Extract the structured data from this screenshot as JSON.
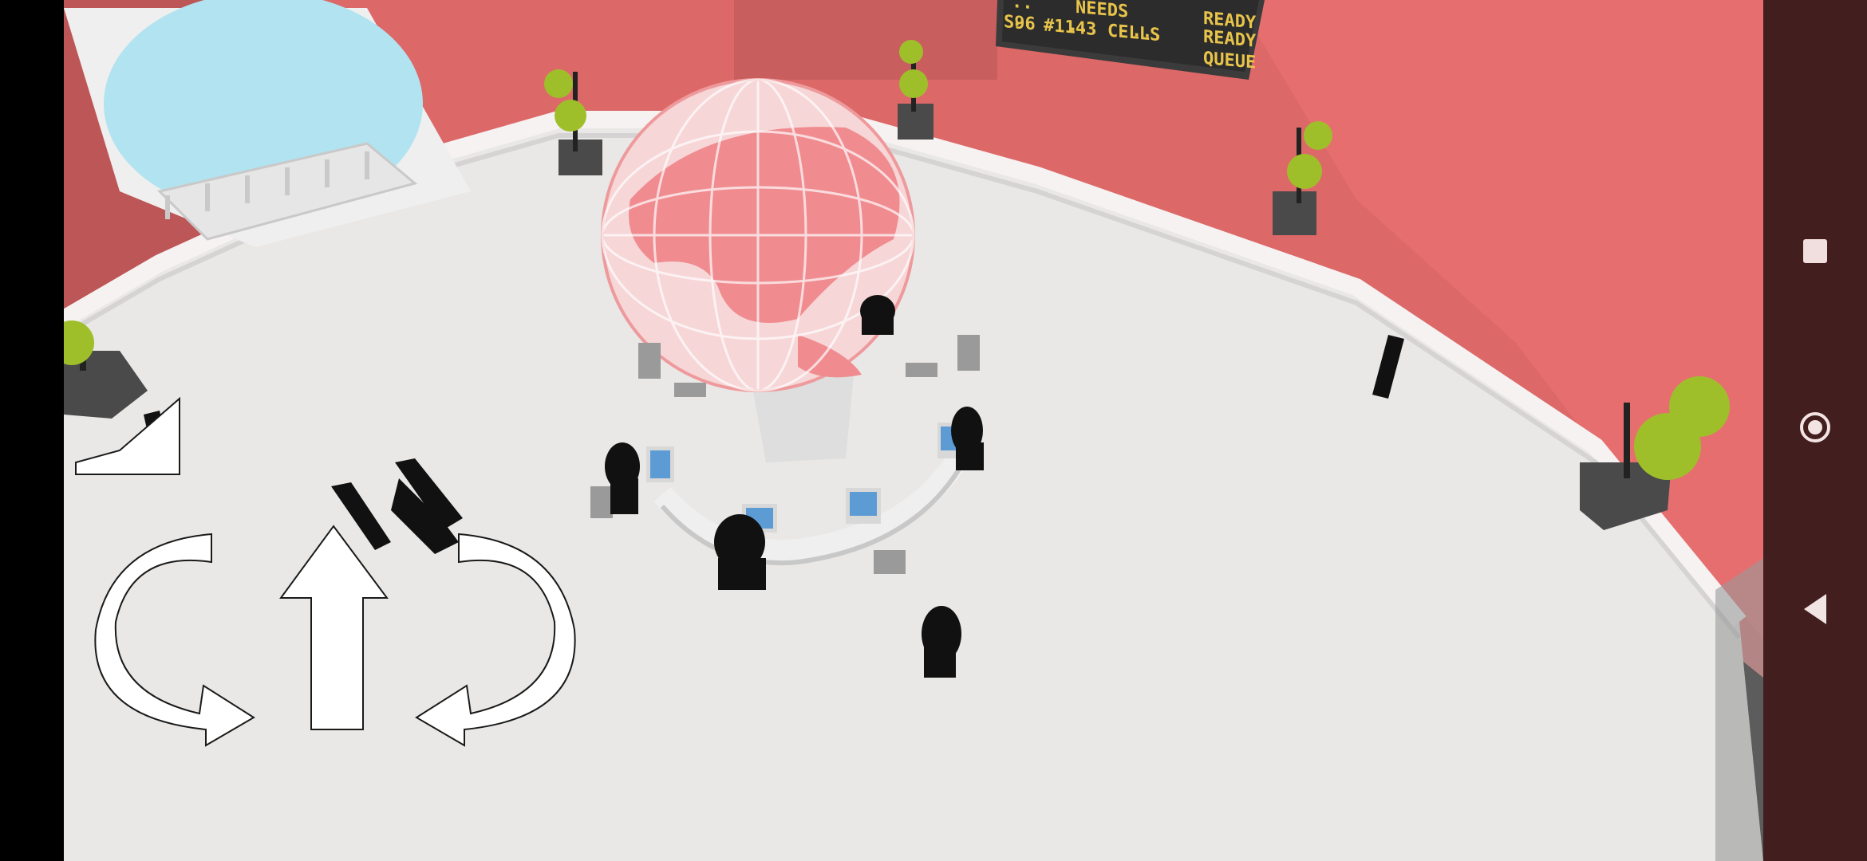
{
  "departure_board": {
    "rows": [
      {
        "code": "..",
        "num": "...",
        "word": "NEEDS",
        "status": "READY"
      },
      {
        "code": "..",
        "num": "...",
        "word": "...",
        "status": "READY"
      },
      {
        "code": "S96",
        "num": "#1143",
        "word": "CELLS",
        "status": "QUEUE"
      }
    ]
  },
  "controls": {
    "rotate_left": "rotate-left-arrow-icon",
    "move_forward": "up-arrow-icon",
    "rotate_right": "rotate-right-arrow-icon",
    "hand_up": "hand-up-icon"
  },
  "nav": {
    "recents": "square-icon",
    "home": "circle-icon",
    "back": "triangle-back-icon"
  },
  "colors": {
    "wall": "#e26d6d",
    "wall_dark": "#c75a5a",
    "floor": "#e9e8e6",
    "sky": "#b2e3f0",
    "board_text": "#e8c44a",
    "globe": "#f08c90",
    "plant": "#9fbf2a"
  }
}
